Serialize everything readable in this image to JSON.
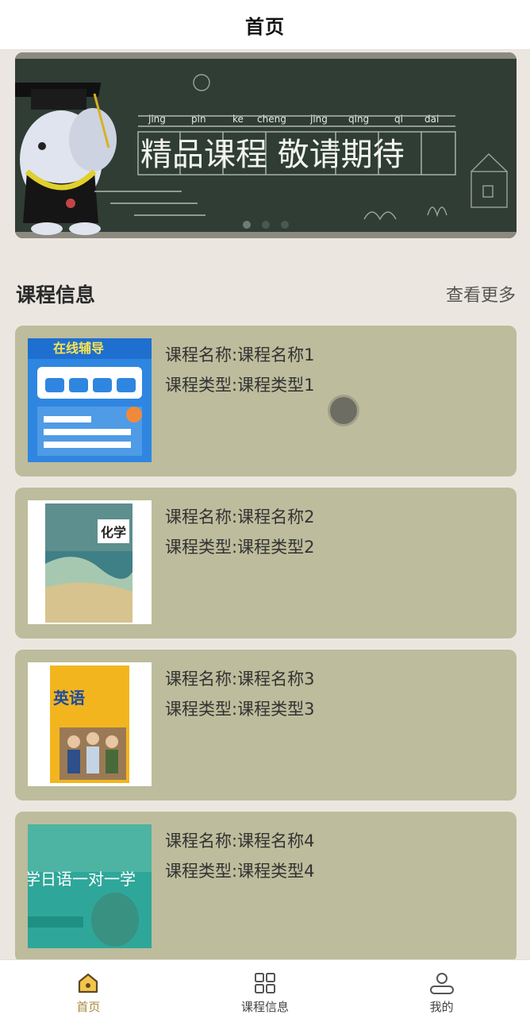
{
  "header": {
    "title": "首页"
  },
  "banner": {
    "pinyin": [
      "jing",
      "pin",
      "ke",
      "cheng",
      "jing",
      "qing",
      "qi",
      "dai"
    ],
    "headline": "精品课程 敬请期待",
    "slides": 3,
    "active_slide": 1
  },
  "section": {
    "title": "课程信息",
    "more": "查看更多"
  },
  "courses": [
    {
      "name": "课程名称:课程名称1",
      "type": "课程类型:课程类型1",
      "cover_text": "在线辅导"
    },
    {
      "name": "课程名称:课程名称2",
      "type": "课程类型:课程类型2",
      "cover_text": "化学"
    },
    {
      "name": "课程名称:课程名称3",
      "type": "课程类型:课程类型3",
      "cover_text": "英语"
    },
    {
      "name": "课程名称:课程名称4",
      "type": "课程类型:课程类型4",
      "cover_text": "学日语一对一学"
    }
  ],
  "tabbar": {
    "items": [
      {
        "label": "首页",
        "icon": "home-icon",
        "active": true
      },
      {
        "label": "课程信息",
        "icon": "grid-icon",
        "active": false
      },
      {
        "label": "我的",
        "icon": "user-icon",
        "active": false
      }
    ]
  },
  "colors": {
    "card_bg": "#bdbc9c",
    "page_bg": "#ebe7e0",
    "accent": "#a88a3c",
    "chalkboard": "#2f3d35"
  }
}
